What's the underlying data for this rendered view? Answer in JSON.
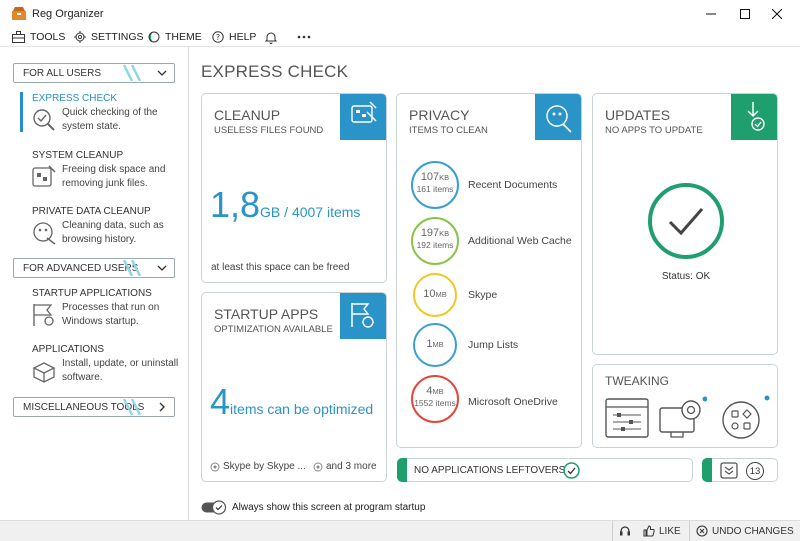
{
  "window": {
    "title": "Reg Organizer"
  },
  "menu": {
    "tools": "TOOLS",
    "settings": "SETTINGS",
    "theme": "THEME",
    "help": "HELP"
  },
  "sidebar": {
    "groups": {
      "all_users": "FOR ALL USERS",
      "advanced": "FOR ADVANCED USERS",
      "misc": "MISCELLANEOUS TOOLS"
    },
    "items": [
      {
        "title": "EXPRESS CHECK",
        "desc": "Quick checking of the system state.",
        "icon": "magnifier-check-icon"
      },
      {
        "title": "SYSTEM CLEANUP",
        "desc": "Freeing disk space and removing junk files.",
        "icon": "cleanup-icon"
      },
      {
        "title": "PRIVATE DATA CLEANUP",
        "desc": "Cleaning data, such as browsing history.",
        "icon": "private-data-icon"
      },
      {
        "title": "STARTUP APPLICATIONS",
        "desc": "Processes that run on Windows startup.",
        "icon": "startup-icon"
      },
      {
        "title": "APPLICATIONS",
        "desc": "Install, update, or uninstall software.",
        "icon": "applications-icon"
      }
    ]
  },
  "main": {
    "title": "EXPRESS CHECK",
    "cleanup": {
      "title": "CLEANUP",
      "subtitle": "USELESS FILES FOUND",
      "value": "1,8",
      "unit": "GB / 4007 items",
      "note": "at least this space can be freed"
    },
    "startup": {
      "title": "STARTUP APPS",
      "subtitle": "OPTIMIZATION AVAILABLE",
      "value": "4",
      "unit": "items can be optimized",
      "app1": "Skype by Skype ...",
      "app2": "and 3 more"
    },
    "privacy": {
      "title": "PRIVACY",
      "subtitle": "ITEMS TO CLEAN",
      "items": [
        {
          "value": "107",
          "unit": "KB",
          "count": "161 items",
          "label": "Recent Documents",
          "color": "#3a9fcf"
        },
        {
          "value": "197",
          "unit": "KB",
          "count": "192 items",
          "label": "Additional Web Cache",
          "color": "#8bc34a"
        },
        {
          "value": "10",
          "unit": "MB",
          "count": "",
          "label": "Skype",
          "color": "#f3c623"
        },
        {
          "value": "1",
          "unit": "MB",
          "count": "",
          "label": "Jump Lists",
          "color": "#3a9fcf"
        },
        {
          "value": "4",
          "unit": "MB",
          "count": "1552 items",
          "label": "Microsoft OneDrive",
          "color": "#e0483c"
        }
      ]
    },
    "updates": {
      "title": "UPDATES",
      "subtitle": "NO APPS TO UPDATE",
      "status": "Status: OK"
    },
    "tweaking": {
      "title": "TWEAKING"
    },
    "leftovers": {
      "label": "NO APPLICATIONS LEFTOVERS"
    },
    "notifications": {
      "count": "13"
    },
    "startup_checkbox": {
      "label": "Always show this screen at program startup"
    }
  },
  "statusbar": {
    "like": "LIKE",
    "undo": "UNDO CHANGES"
  },
  "colors": {
    "accent_blue": "#2a94c8",
    "accent_green": "#1f9e6e",
    "border": "#c9d3d6"
  }
}
